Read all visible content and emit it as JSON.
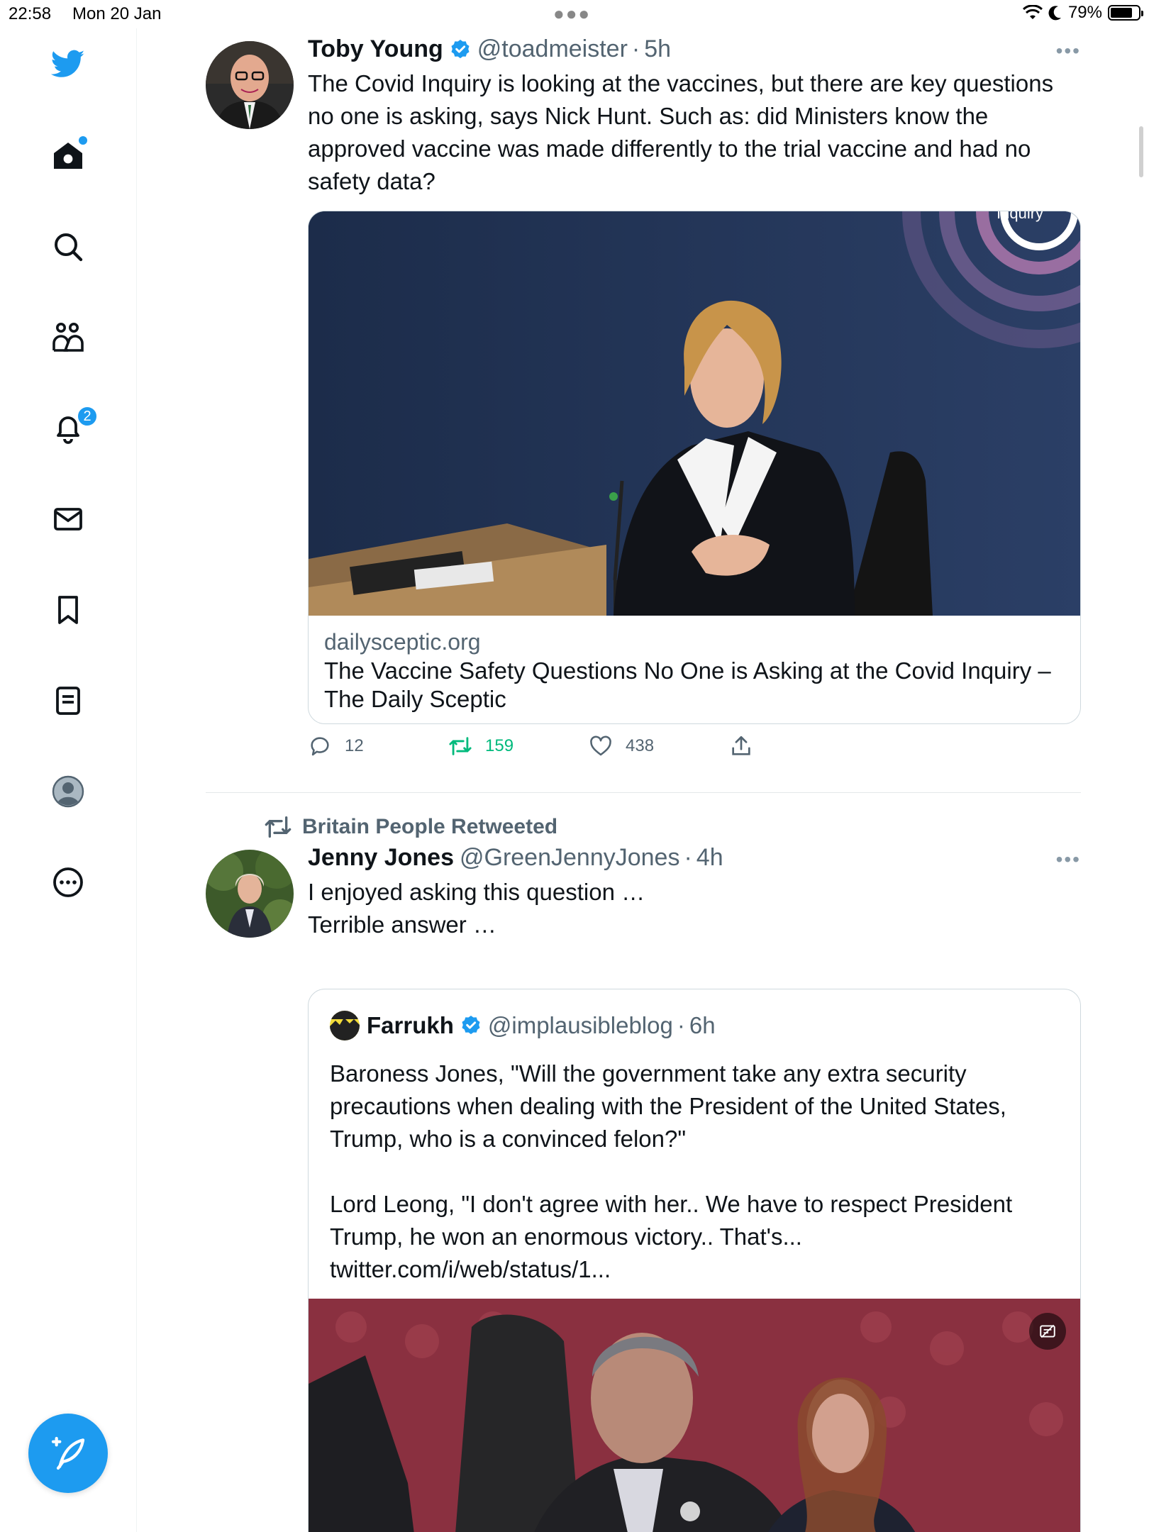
{
  "status_bar": {
    "time": "22:58",
    "date": "Mon 20 Jan",
    "battery": "79%",
    "battery_level": 0.79
  },
  "sidebar": {
    "items": [
      {
        "icon": "twitter-bird-icon"
      },
      {
        "icon": "home-icon"
      },
      {
        "icon": "search-icon"
      },
      {
        "icon": "communities-icon"
      },
      {
        "icon": "bell-icon",
        "badge": "2"
      },
      {
        "icon": "mail-icon"
      },
      {
        "icon": "bookmark-icon"
      },
      {
        "icon": "lists-icon"
      },
      {
        "icon": "profile-avatar-icon"
      },
      {
        "icon": "more-circle-icon"
      }
    ],
    "compose_icon": "compose-feather-icon"
  },
  "colors": {
    "accent": "#1d9bf0",
    "retweet_green": "#00ba7c",
    "secondary_text": "#536471"
  },
  "tweet1": {
    "name": "Toby Young",
    "handle": "@toadmeister",
    "time": "5h",
    "text": "The Covid Inquiry is looking at the vaccines, but there are key questions no one is asking, says Nick Hunt. Such as: did Ministers know the approved vaccine was made differently to the trial vaccine and had no safety data?",
    "card": {
      "domain": "dailysceptic.org",
      "title": "The Vaccine Safety Questions No One is Asking at the Covid Inquiry – The Daily Sceptic",
      "image_watermark": "Inquiry"
    },
    "replies": "12",
    "retweets": "159",
    "likes": "438"
  },
  "tweet2": {
    "retweeted_by": "Britain People Retweeted",
    "name": "Jenny Jones",
    "handle": "@GreenJennyJones",
    "time": "4h",
    "text": "I enjoyed asking this question …\nTerrible answer …",
    "quote": {
      "name": "Farrukh",
      "handle": "@implausibleblog",
      "time": "6h",
      "text": "Baroness Jones, \"Will the government take any extra security precautions when dealing with the President of the United States, Trump, who is a convinced felon?\"\n\nLord Leong, \"I don't agree with her.. We have to respect President Trump, he won an enormous victory.. That's... twitter.com/i/web/status/1..."
    }
  }
}
